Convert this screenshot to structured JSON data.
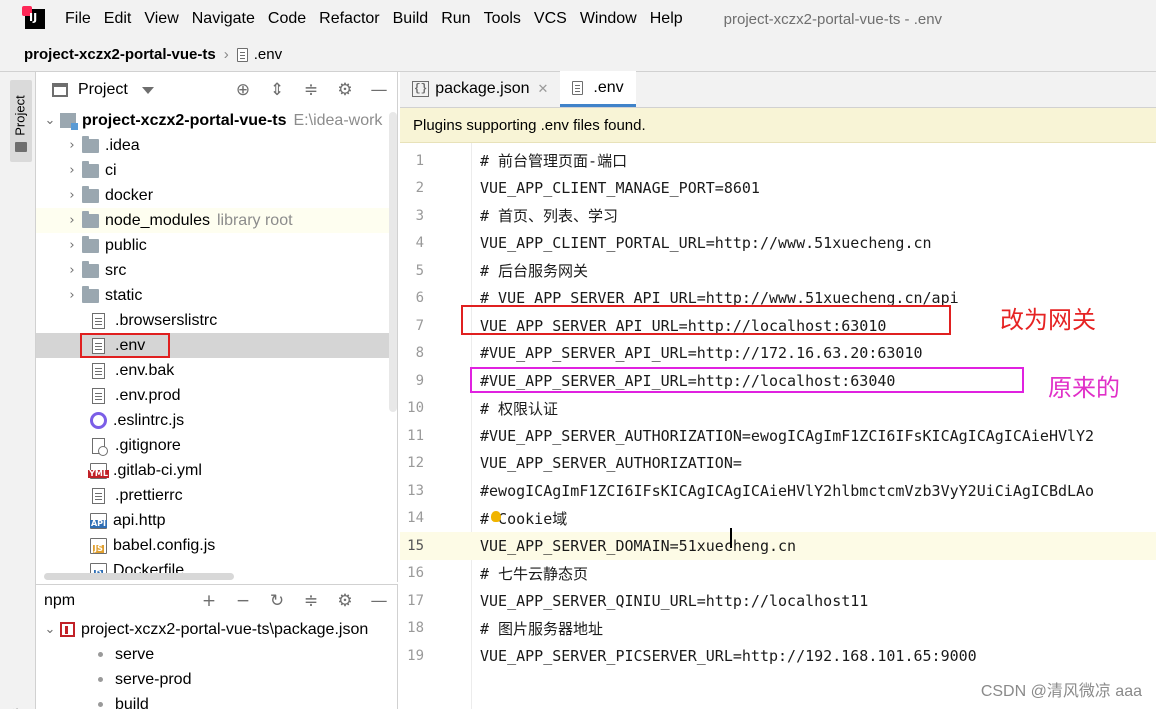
{
  "menubar": {
    "items": [
      "File",
      "Edit",
      "View",
      "Navigate",
      "Code",
      "Refactor",
      "Build",
      "Run",
      "Tools",
      "VCS",
      "Window",
      "Help"
    ],
    "window_title": "project-xczx2-portal-vue-ts - .env"
  },
  "breadcrumb": {
    "project": "project-xczx2-portal-vue-ts",
    "file": ".env"
  },
  "left_stripe": {
    "project_label": "Project",
    "bookmarks_label": "narks"
  },
  "project_panel": {
    "title": "Project",
    "root_name": "project-xczx2-portal-vue-ts",
    "root_path": "E:\\idea-work",
    "items": [
      {
        "name": ".idea",
        "type": "folder"
      },
      {
        "name": "ci",
        "type": "folder"
      },
      {
        "name": "docker",
        "type": "folder"
      },
      {
        "name": "node_modules",
        "type": "folder",
        "hint": "library root"
      },
      {
        "name": "public",
        "type": "folder"
      },
      {
        "name": "src",
        "type": "folder"
      },
      {
        "name": "static",
        "type": "folder"
      },
      {
        "name": ".browserslistrc",
        "type": "file"
      },
      {
        "name": ".env",
        "type": "file"
      },
      {
        "name": ".env.bak",
        "type": "file"
      },
      {
        "name": ".env.prod",
        "type": "file"
      },
      {
        "name": ".eslintrc.js",
        "type": "eslint"
      },
      {
        "name": ".gitignore",
        "type": "ignore"
      },
      {
        "name": ".gitlab-ci.yml",
        "type": "yml"
      },
      {
        "name": ".prettierrc",
        "type": "file"
      },
      {
        "name": "api.http",
        "type": "api"
      },
      {
        "name": "babel.config.js",
        "type": "js"
      },
      {
        "name": "Dockerfile",
        "type": "docker"
      }
    ]
  },
  "npm_panel": {
    "title": "npm",
    "package": "project-xczx2-portal-vue-ts\\package.json",
    "scripts": [
      "serve",
      "serve-prod",
      "build"
    ]
  },
  "editor": {
    "tabs": [
      {
        "label": "package.json",
        "active": false
      },
      {
        "label": ".env",
        "active": true
      }
    ],
    "notice": "Plugins supporting .env files found.",
    "current_line": 15,
    "lines": [
      {
        "num": "1",
        "text": "# 前台管理页面-端口"
      },
      {
        "num": "2",
        "text": "VUE_APP_CLIENT_MANAGE_PORT=8601"
      },
      {
        "num": "3",
        "text": "# 首页、列表、学习"
      },
      {
        "num": "4",
        "text": "VUE_APP_CLIENT_PORTAL_URL=http://www.51xuecheng.cn"
      },
      {
        "num": "5",
        "text": "# 后台服务网关"
      },
      {
        "num": "6",
        "text": "# VUE_APP_SERVER_API_URL=http://www.51xuecheng.cn/api"
      },
      {
        "num": "7",
        "text": "VUE_APP_SERVER_API_URL=http://localhost:63010"
      },
      {
        "num": "8",
        "text": "#VUE_APP_SERVER_API_URL=http://172.16.63.20:63010"
      },
      {
        "num": "9",
        "text": "#VUE_APP_SERVER_API_URL=http://localhost:63040"
      },
      {
        "num": "10",
        "text": "# 权限认证"
      },
      {
        "num": "11",
        "text": "#VUE_APP_SERVER_AUTHORIZATION=ewogICAgImF1ZCI6IFsKICAgICAgICAieHVlY2"
      },
      {
        "num": "12",
        "text": "VUE_APP_SERVER_AUTHORIZATION="
      },
      {
        "num": "13",
        "text": "#ewogICAgImF1ZCI6IFsKICAgICAgICAieHVlY2hlbmctcmVzb3VyY2UiCiAgICBdLAo"
      },
      {
        "num": "14",
        "text": "# Cookie域"
      },
      {
        "num": "15",
        "text": "VUE_APP_SERVER_DOMAIN=51xuecheng.cn"
      },
      {
        "num": "16",
        "text": "# 七牛云静态页"
      },
      {
        "num": "17",
        "text": "VUE_APP_SERVER_QINIU_URL=http://localhost11"
      },
      {
        "num": "18",
        "text": "# 图片服务器地址"
      },
      {
        "num": "19",
        "text": "VUE_APP_SERVER_PICSERVER_URL=http://192.168.101.65:9000"
      }
    ]
  },
  "annotations": {
    "red_note": "改为网关",
    "pink_note": "原来的",
    "red_color": "#e02020",
    "pink_color": "#e021e0"
  },
  "watermark": "CSDN @清风微凉 aaa"
}
